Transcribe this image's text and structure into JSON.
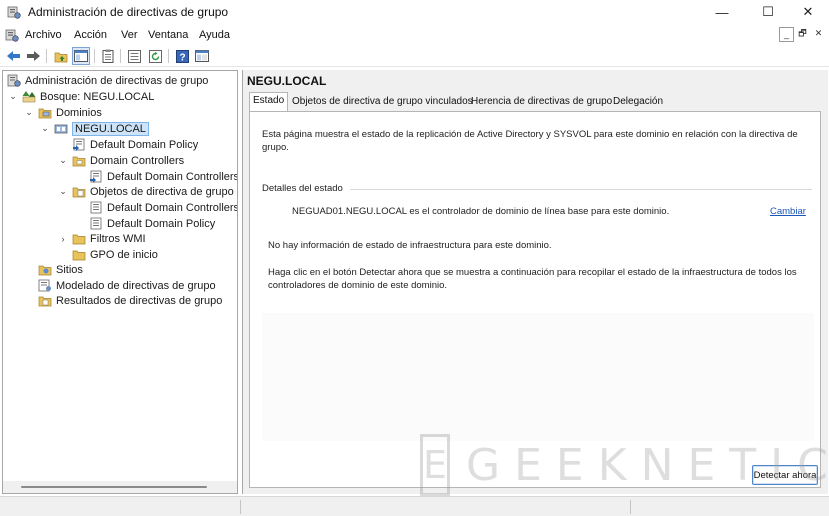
{
  "window": {
    "title": "Administración de directivas de grupo",
    "minimize_glyph": "—",
    "maximize_glyph": "☐",
    "close_glyph": "✕"
  },
  "menubar": {
    "items": [
      "Archivo",
      "Acción",
      "Ver",
      "Ventana",
      "Ayuda"
    ],
    "mdi": {
      "minimize": "_",
      "restore": "🗗",
      "close": "✕"
    }
  },
  "toolbar": {
    "icons": [
      "back-arrow-icon",
      "forward-arrow-icon",
      "up-folder-icon",
      "show-hide-tree-icon",
      "properties-icon",
      "export-list-icon",
      "refresh-icon",
      "help-icon",
      "console-view-icon"
    ]
  },
  "tree": {
    "root": "Administración de directivas de grupo",
    "forest": "Bosque: NEGU.LOCAL",
    "domains": "Dominios",
    "domain": "NEGU.LOCAL",
    "default_domain_policy": "Default Domain Policy",
    "domain_controllers": "Domain Controllers",
    "default_domain_controllers": "Default Domain Controllers",
    "gpo_objects": "Objetos de directiva de grupo",
    "gpo_default_domain_controllers": "Default Domain Controllers",
    "gpo_default_domain_policy": "Default Domain Policy",
    "wmi_filters": "Filtros WMI",
    "starter_gpos": "GPO de inicio",
    "sites": "Sitios",
    "modeling": "Modelado de directivas de grupo",
    "results": "Resultados de directivas de grupo"
  },
  "main": {
    "title": "NEGU.LOCAL",
    "tabs": [
      "Estado",
      "Objetos de directiva de grupo vinculados",
      "Herencia de directivas de grupo",
      "Delegación"
    ],
    "description": "Esta página muestra el estado de la replicación de Active Directory y SYSVOL para este dominio en relación con la directiva de grupo.",
    "details_label": "Detalles del estado",
    "baseline_text": "NEGUAD01.NEGU.LOCAL es el controlador de dominio de línea base para este dominio.",
    "change_link": "Cambiar",
    "infra_none": "No hay información de estado de infraestructura para este dominio.",
    "infra_help": "Haga clic en el botón Detectar ahora que se muestra a continuación para recopilar el estado de la infraestructura de todos los controladores de dominio de este dominio.",
    "detect_button": "Detectar ahora"
  },
  "watermark": {
    "letter": "E",
    "text": "GEEKNETIC"
  },
  "colors": {
    "selection": "#cde3f7",
    "link": "#1a56b8",
    "panel_bg": "#f0f0f0",
    "folder": "#e8c25a"
  }
}
